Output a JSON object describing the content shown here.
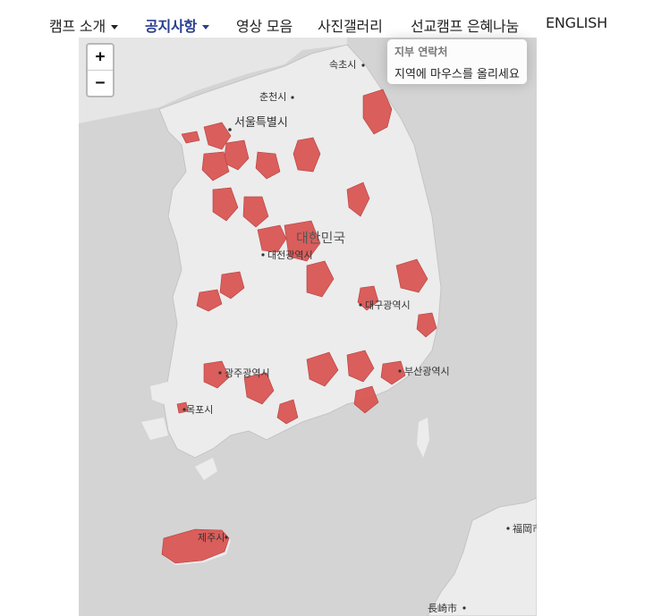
{
  "nav": {
    "items": [
      {
        "label": "캠프 소개",
        "has_caret": true,
        "active": false
      },
      {
        "label": "공지사항",
        "has_caret": true,
        "active": true
      },
      {
        "label": "영상 모음",
        "has_caret": false,
        "active": false
      },
      {
        "label": "사진갤러리",
        "has_caret": false,
        "active": false
      },
      {
        "label": "선교캠프 은혜나눔",
        "has_caret": false,
        "active": false
      },
      {
        "label": "ENGLISH",
        "has_caret": false,
        "active": false
      }
    ],
    "active_color": "#2a3e8f"
  },
  "map": {
    "zoom_in_label": "+",
    "zoom_out_label": "−",
    "info": {
      "title": "지부 연락처",
      "text": "지역에 마우스를 올리세요"
    },
    "labels": {
      "sokcho": "속초시",
      "chuncheon": "춘천시",
      "seoul": "서울특별시",
      "korea": "대한민국",
      "daejeon": "대전광역시",
      "daegu": "대구광역시",
      "gwangju": "광주광역시",
      "busan": "부산광역시",
      "mokpo": "목포시",
      "jeju": "제주시",
      "fukuoka": "福岡市",
      "nagasaki": "長崎市"
    },
    "colors": {
      "sea": "#d4d4d4",
      "land": "#ececec",
      "region_fill": "#d9534f",
      "region_stroke": "#b03030"
    }
  }
}
